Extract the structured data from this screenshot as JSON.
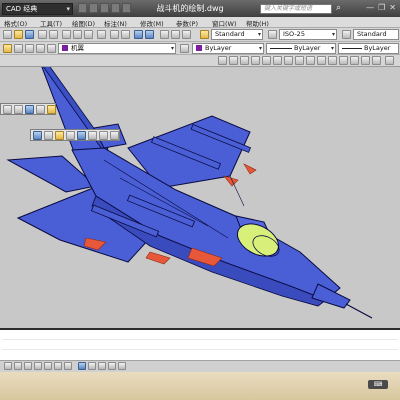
{
  "app": {
    "workspace": "CAD 经典",
    "document_title": "战斗机的绘制.dwg",
    "search_placeholder": "键入关键字或短语"
  },
  "window_controls": [
    "—",
    "❐",
    "✕"
  ],
  "menu": [
    {
      "label": "格式(O)"
    },
    {
      "label": "工具(T)"
    },
    {
      "label": "绘图(D)"
    },
    {
      "label": "标注(N)"
    },
    {
      "label": "修改(M)"
    },
    {
      "label": "参数(P)"
    },
    {
      "label": "窗口(W)"
    },
    {
      "label": "帮助(H)"
    }
  ],
  "toolbars": {
    "text_style": "Standard",
    "dim_style": "ISO-25",
    "table_style": "Standard",
    "layer": "机翼",
    "color": "ByLayer",
    "linetype": "ByLayer",
    "lineweight": "ByLayer"
  },
  "drawing": {
    "subject": "fighter jet 3D model",
    "fuselage_color": "#4a5fd6",
    "edge_color": "#0a0a40",
    "canopy_color": "#d8f07a",
    "missile_color": "#e8573a"
  }
}
